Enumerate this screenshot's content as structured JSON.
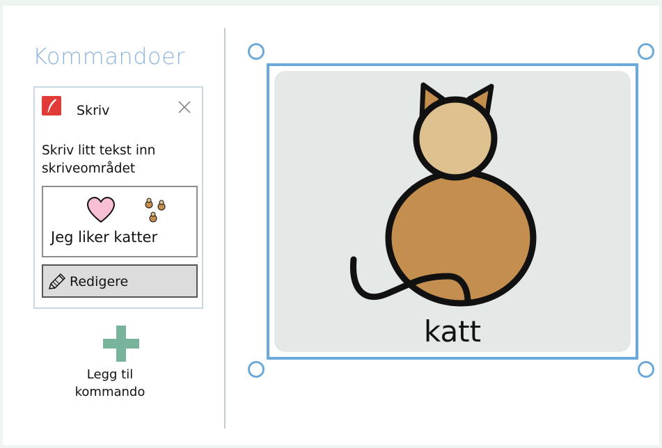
{
  "panel": {
    "title": "Kommandoer"
  },
  "command": {
    "title": "Skriv",
    "icon": "quill-pen-icon",
    "description": "Skriv litt tekst inn skriveområdet",
    "write_area_text": "Jeg liker katter",
    "edit_button_label": "Redigere"
  },
  "add_command": {
    "label_line1": "Legg til",
    "label_line2": "kommando",
    "icon": "plus-icon"
  },
  "symbol": {
    "label": "katt",
    "image": "cat-symbol"
  },
  "colors": {
    "accent_blue": "#6aa9d9",
    "title_blue": "#8fb4de",
    "command_red": "#e03b36",
    "add_green": "#78b49b",
    "cat_body": "#c48e4f",
    "cat_head": "#dfc190"
  }
}
